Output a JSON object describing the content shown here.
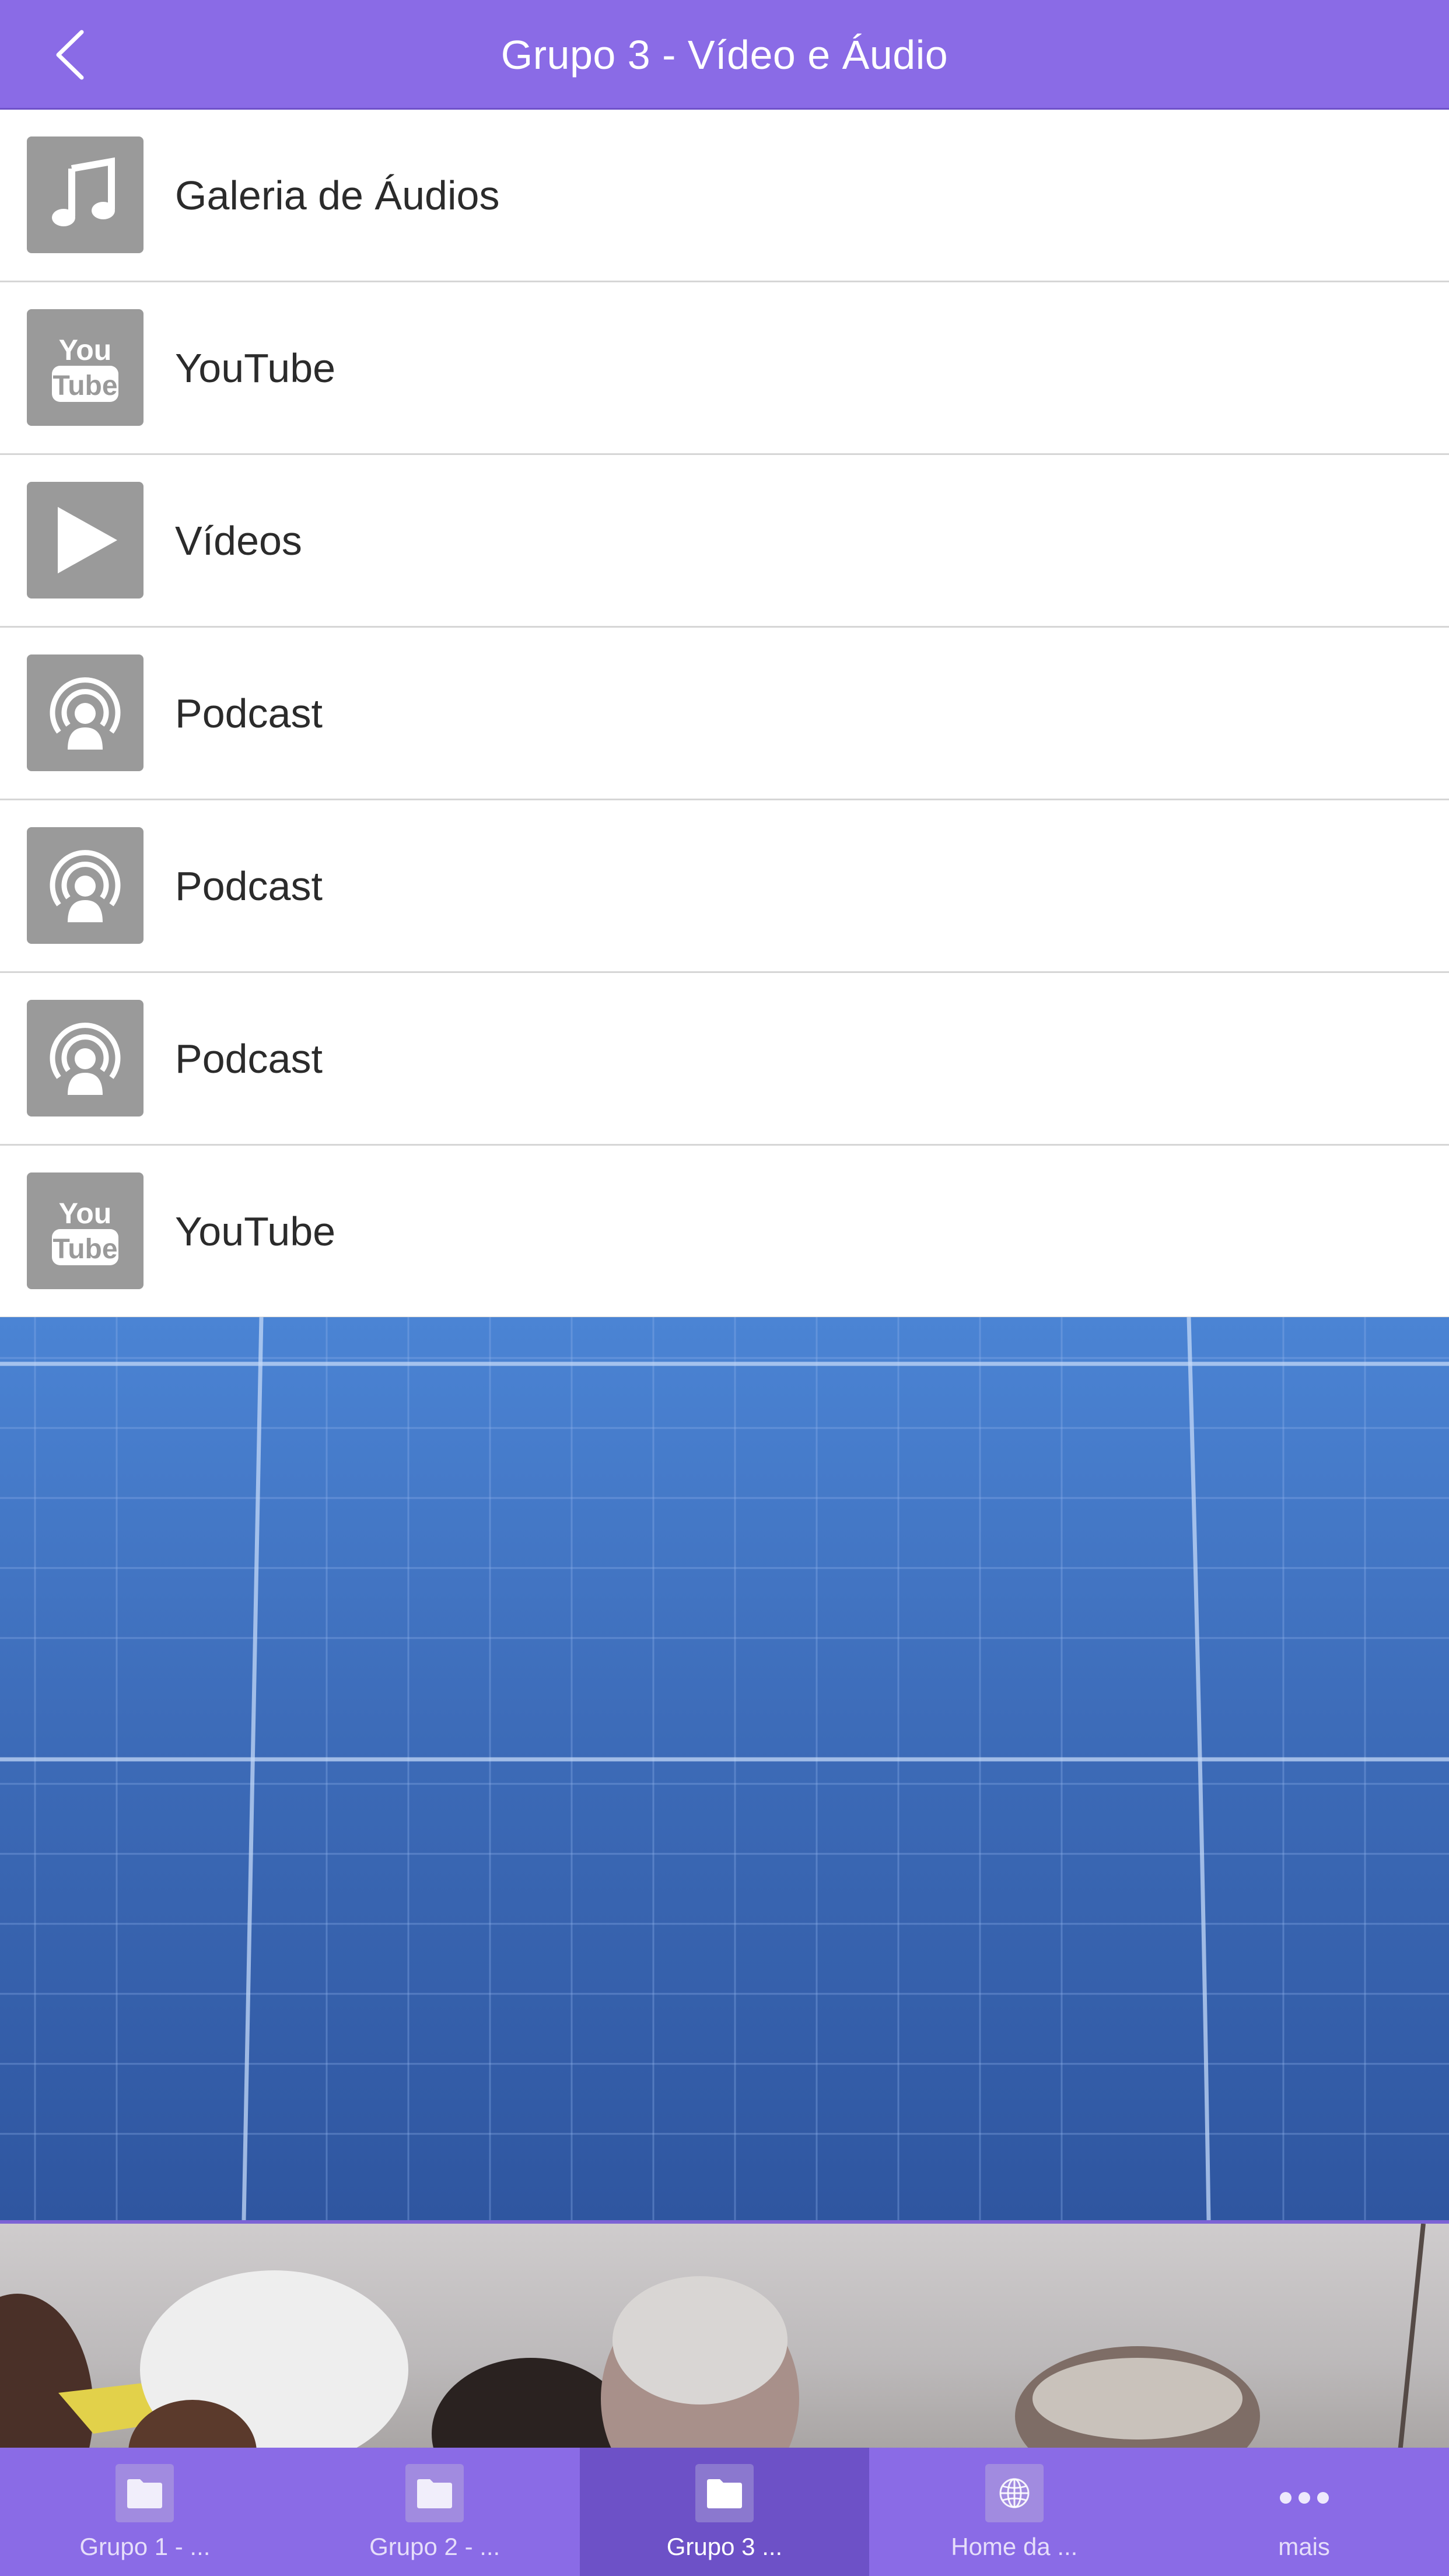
{
  "header": {
    "title": "Grupo 3 - Vídeo e Áudio",
    "back_icon": "chevron-left-icon"
  },
  "colors": {
    "accent": "#8a6be6",
    "accent_active": "#6d51c7",
    "icon_tile": "#9a9a9a",
    "divider": "#d6d6d6",
    "text": "#2b2b2b"
  },
  "list": {
    "items": [
      {
        "label": "Galeria de Áudios",
        "icon": "music-note-icon"
      },
      {
        "label": "YouTube",
        "icon": "youtube-icon"
      },
      {
        "label": "Vídeos",
        "icon": "play-icon"
      },
      {
        "label": "Podcast",
        "icon": "podcast-icon"
      },
      {
        "label": "Podcast",
        "icon": "podcast-icon"
      },
      {
        "label": "Podcast",
        "icon": "podcast-icon"
      },
      {
        "label": "YouTube",
        "icon": "youtube-icon"
      }
    ]
  },
  "tabbar": {
    "tabs": [
      {
        "label": "Grupo 1 - ...",
        "icon": "folder-icon",
        "active": false
      },
      {
        "label": "Grupo 2 - ...",
        "icon": "folder-icon",
        "active": false
      },
      {
        "label": "Grupo 3 ...",
        "icon": "folder-icon",
        "active": true
      },
      {
        "label": "Home da ...",
        "icon": "globe-icon",
        "active": false
      },
      {
        "label": "mais",
        "icon": "more-dots-icon",
        "active": false
      }
    ]
  }
}
